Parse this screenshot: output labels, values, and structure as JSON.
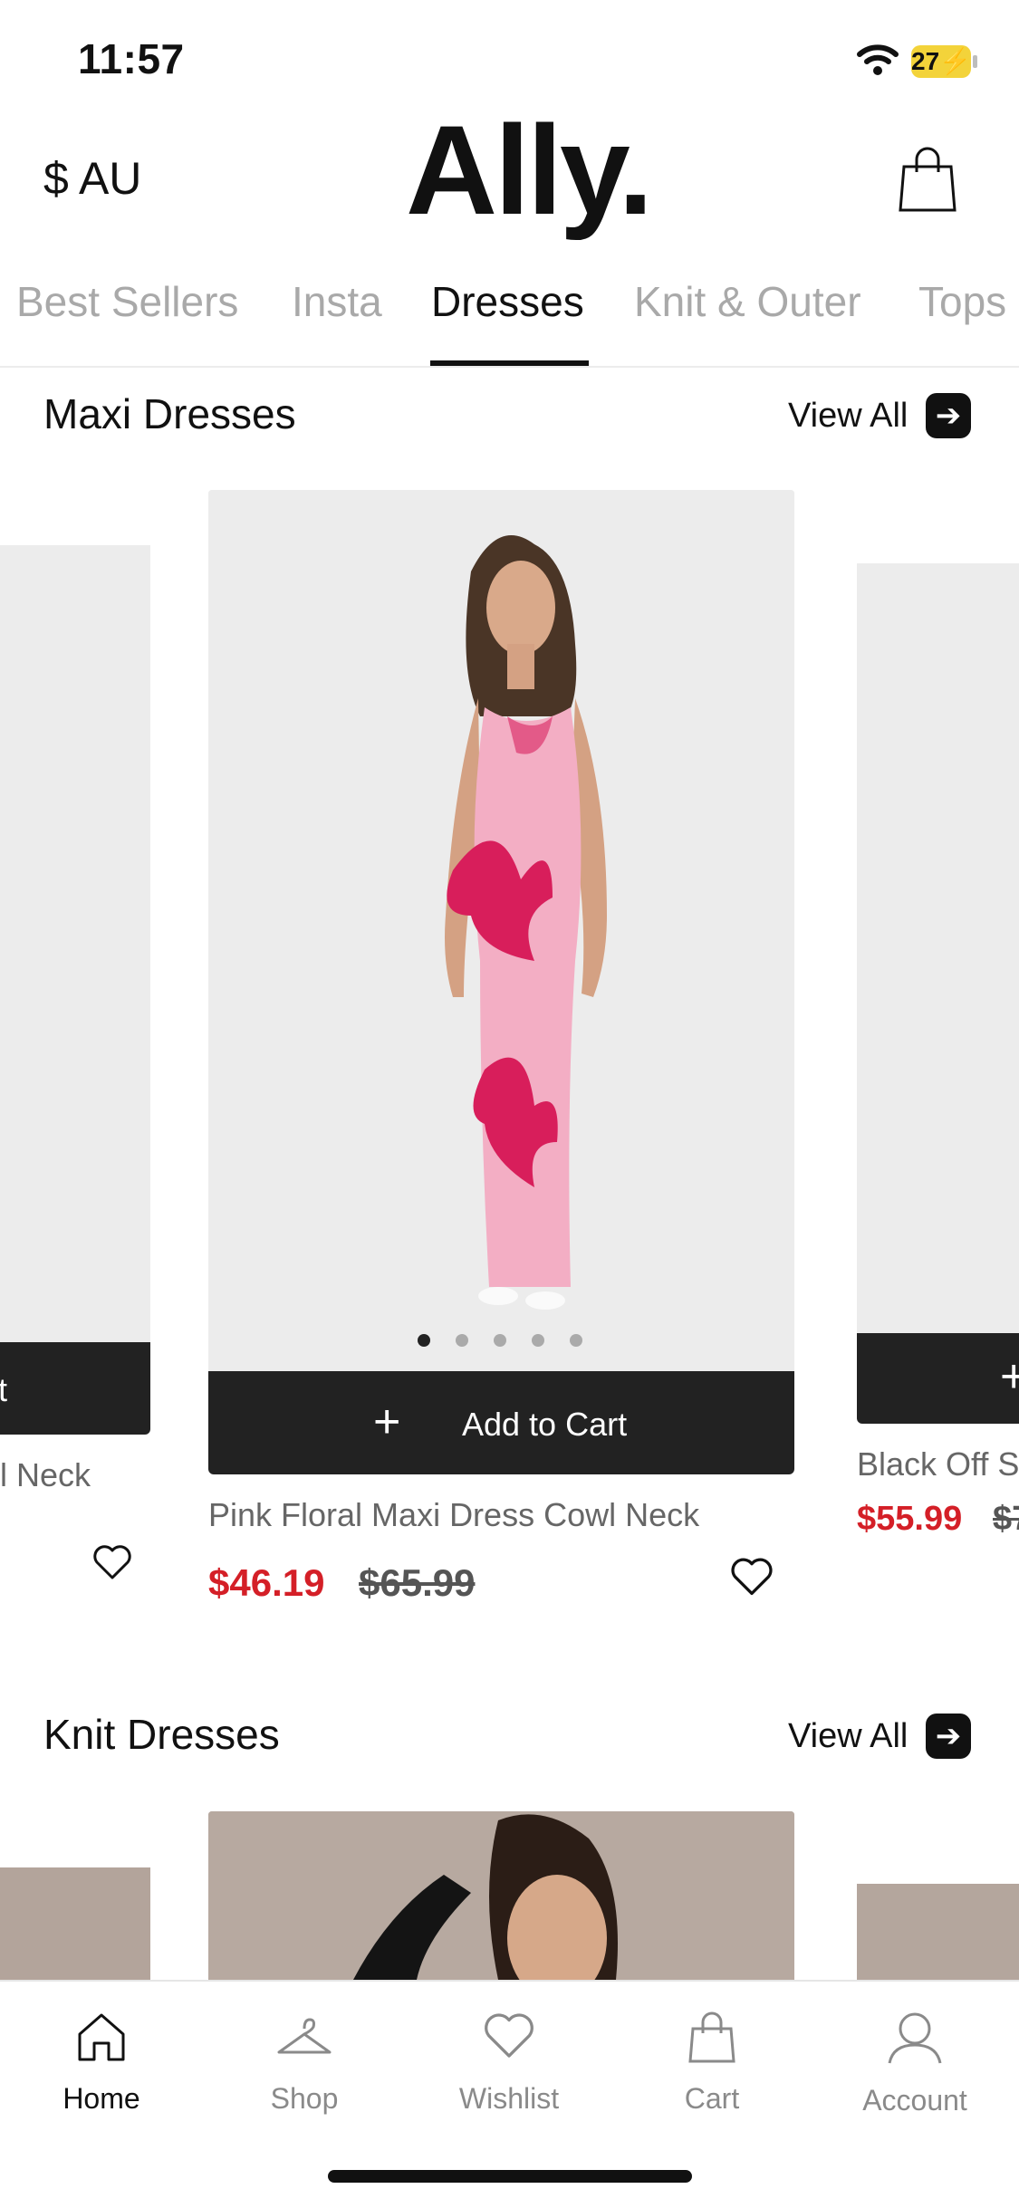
{
  "status_bar": {
    "time": "11:57",
    "battery": "27"
  },
  "header": {
    "currency": "$ AU",
    "logo": "Ally.",
    "bag_icon": "shopping-bag-icon"
  },
  "tabs": [
    {
      "label": "Best Sellers"
    },
    {
      "label": "Insta"
    },
    {
      "label": "Dresses",
      "active": true
    },
    {
      "label": "Knit & Outer"
    },
    {
      "label": "Tops"
    }
  ],
  "sections": [
    {
      "title": "Maxi Dresses",
      "view_all": "View All",
      "products": [
        {
          "name": "l Neck",
          "cart_label": "t"
        },
        {
          "name": "Pink Floral Maxi Dress Cowl Neck",
          "cart_label": "Add to Cart",
          "price": "$46.19",
          "original_price": "$65.99"
        },
        {
          "name": "Black Off Sh",
          "price": "$55.99",
          "original_price": "$7"
        }
      ]
    },
    {
      "title": "Knit Dresses",
      "view_all": "View All"
    }
  ],
  "bottom_nav": [
    {
      "label": "Home",
      "icon": "home-icon",
      "active": true
    },
    {
      "label": "Shop",
      "icon": "hanger-icon"
    },
    {
      "label": "Wishlist",
      "icon": "heart-icon"
    },
    {
      "label": "Cart",
      "icon": "bag-icon"
    },
    {
      "label": "Account",
      "icon": "user-icon"
    }
  ],
  "colors": {
    "sale": "#d41f27",
    "dark_bar": "#222222",
    "battery": "#f3d33a"
  }
}
